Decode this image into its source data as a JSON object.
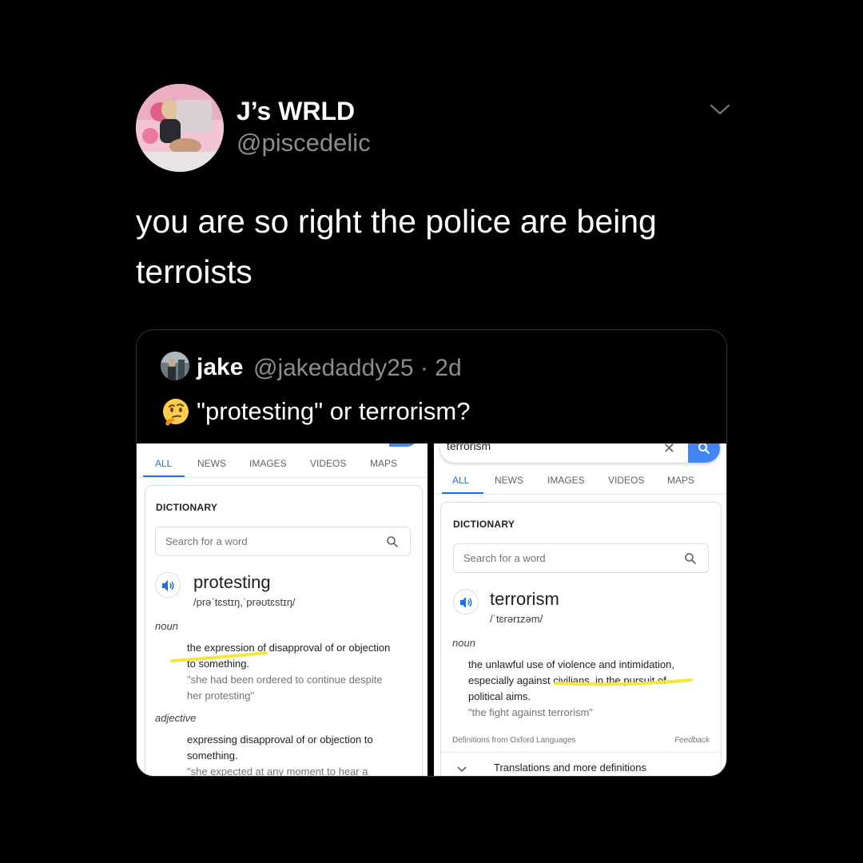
{
  "tweet": {
    "display_name": "J’s WRLD",
    "handle": "@piscedelic",
    "text_line1": "you are so right the police are being",
    "text_line2": "terroists"
  },
  "quote": {
    "name": "jake",
    "handle_time": "@jakedaddy25 · 2d",
    "text": "\"protesting\" or terrorism?",
    "emoji": "thinking-face-emoji"
  },
  "left_shot": {
    "tabs": [
      "ALL",
      "NEWS",
      "IMAGES",
      "VIDEOS",
      "MAPS"
    ],
    "dictionary_title": "DICTIONARY",
    "search_placeholder": "Search for a word",
    "headword": "protesting",
    "phonetic": "/prəˈtɛstɪŋ,ˈprəʊtɛstɪŋ/",
    "pos1": "noun",
    "def1_line1": "the expression of disapproval of or objection",
    "def1_line2": "to something.",
    "ex1_line1": "\"she had been ordered to continue despite",
    "ex1_line2": "her protesting\"",
    "pos2": "adjective",
    "def2_line1": "expressing disapproval of or objection to",
    "def2_line2": "something.",
    "ex2_line1": "\"she expected at any moment to hear a"
  },
  "right_shot": {
    "query": "terrorism",
    "tabs": [
      "ALL",
      "NEWS",
      "IMAGES",
      "VIDEOS",
      "MAPS"
    ],
    "dictionary_title": "DICTIONARY",
    "search_placeholder": "Search for a word",
    "headword": "terrorism",
    "phonetic": "/ˈtɛrərɪzəm/",
    "pos1": "noun",
    "def1_line1": "the unlawful use of violence and intimidation,",
    "def1_line2": "especially against civilians, in the pursuit of",
    "def1_line3": "political aims.",
    "ex1": "\"the fight against terrorism\"",
    "source": "Definitions from Oxford Languages",
    "feedback": "Feedback",
    "translations": "Translations and more definitions"
  },
  "colors": {
    "background": "#000000",
    "secondary_text": "#8a8d91",
    "google_blue": "#1a73e8",
    "highlight_yellow": "#f5e63a"
  }
}
